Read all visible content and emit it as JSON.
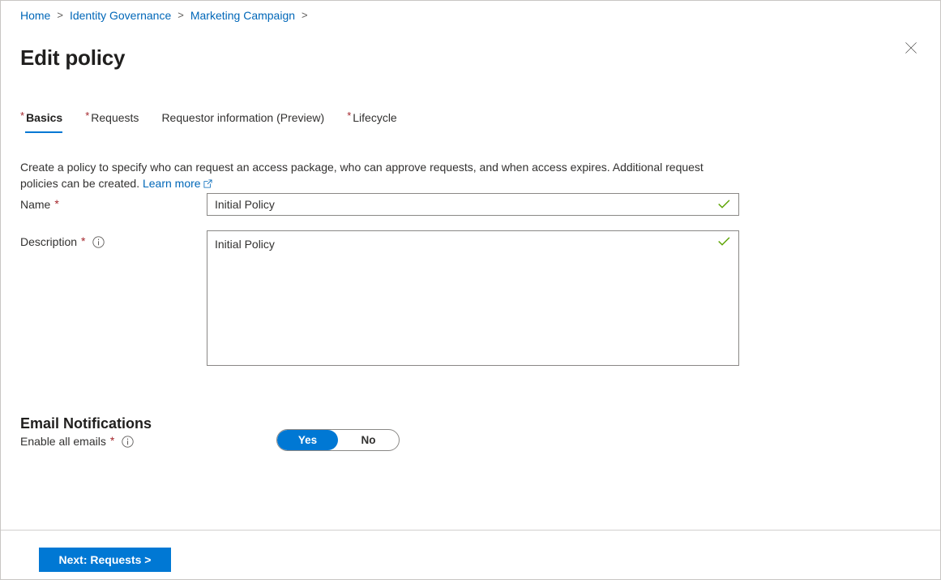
{
  "breadcrumb": {
    "separator": ">",
    "items": [
      {
        "label": "Home"
      },
      {
        "label": "Identity Governance"
      },
      {
        "label": "Marketing Campaign"
      }
    ],
    "trailing_separator": ">"
  },
  "header": {
    "title": "Edit policy",
    "close_icon": "close-icon"
  },
  "tabs": [
    {
      "label": "Basics",
      "required": true,
      "active": true
    },
    {
      "label": "Requests",
      "required": true,
      "active": false
    },
    {
      "label": "Requestor information (Preview)",
      "required": false,
      "active": false
    },
    {
      "label": "Lifecycle",
      "required": true,
      "active": false
    }
  ],
  "intro": {
    "text": "Create a policy to specify who can request an access package, who can approve requests, and when access expires. Additional request policies can be created.",
    "link_label": "Learn more",
    "link_icon": "external-link-icon"
  },
  "form": {
    "name": {
      "label": "Name",
      "required_marker": "*",
      "value": "Initial Policy",
      "placeholder": "",
      "valid_icon": "green-checkmark-icon"
    },
    "description": {
      "label": "Description",
      "required_marker": "*",
      "info_icon": "info-icon",
      "value": "Initial Policy",
      "placeholder": "",
      "valid_icon": "green-checkmark-icon"
    }
  },
  "email_notifications": {
    "heading": "Email Notifications",
    "enable_all": {
      "label": "Enable all emails",
      "required_marker": "*",
      "info_icon": "info-icon",
      "selected": "Yes",
      "options": [
        "Yes",
        "No"
      ]
    }
  },
  "footer": {
    "next_label": "Next: Requests >"
  },
  "colors": {
    "accent": "#0078d4",
    "link": "#0067b8",
    "required_star": "#a4262c",
    "valid_check": "#5ba300",
    "border": "#8a8886"
  }
}
